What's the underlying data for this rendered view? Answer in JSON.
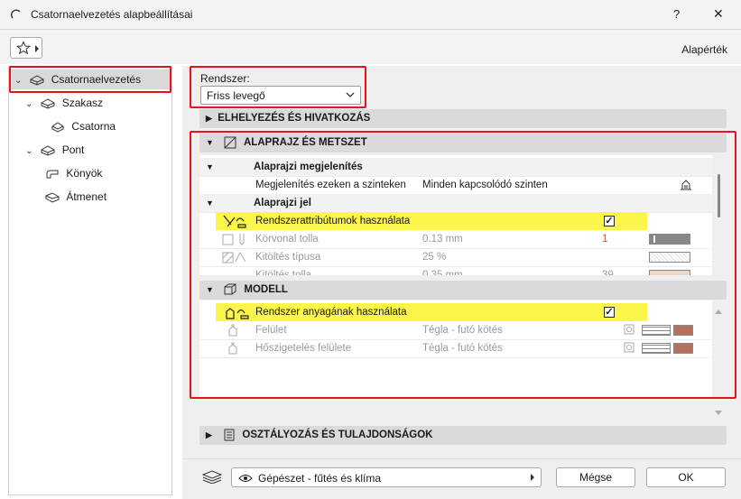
{
  "window": {
    "title": "Csatornaelvezetés alapbeállításai",
    "help": "?",
    "close": "✕"
  },
  "toolbar": {
    "defaults_label": "Alapérték"
  },
  "tree": {
    "items": [
      {
        "label": "Csatornaelvezetés",
        "expanded": true
      },
      {
        "label": "Szakasz",
        "expanded": true
      },
      {
        "label": "Csatorna"
      },
      {
        "label": "Pont",
        "expanded": true
      },
      {
        "label": "Könyök"
      },
      {
        "label": "Átmenet"
      }
    ]
  },
  "system": {
    "label": "Rendszer:",
    "value": "Friss levegő"
  },
  "sections": {
    "placement": "ELHELYEZÉS ÉS HIVATKOZÁS",
    "plan": "ALAPRAJZ ÉS METSZET",
    "model": "MODELL",
    "classification": "OSZTÁLYOZÁS ÉS TULAJDONSÁGOK"
  },
  "plan": {
    "display_header": "Alaprajzi megjelenítés",
    "show_on_label": "Megjelenítés ezeken a szinteken",
    "show_on_value": "Minden kapcsolódó szinten",
    "symbol_header": "Alaprajzi jel",
    "use_system_attrs": "Rendszerattribútumok használata",
    "contour_pen_label": "Körvonal tolla",
    "contour_pen_value": "0.13 mm",
    "contour_pen_num": "1",
    "fill_type_label": "Kitöltés típusa",
    "fill_type_value": "25 %",
    "fill_pen_label": "Kitöltés tolla",
    "fill_pen_value": "0.35 mm",
    "fill_pen_num": "39"
  },
  "model": {
    "use_system_material": "Rendszer anyagának használata",
    "surface_label": "Felület",
    "surface_value": "Tégla - futó kötés",
    "insulation_label": "Hőszigetelés felülete",
    "insulation_value": "Tégla - futó kötés"
  },
  "footer": {
    "layer": "Gépészet - fűtés és klíma",
    "cancel": "Mégse",
    "ok": "OK"
  },
  "colors": {
    "highlight": "#fcf54a",
    "annotation": "#e8131b",
    "swatch_brick": "#b5705f"
  }
}
